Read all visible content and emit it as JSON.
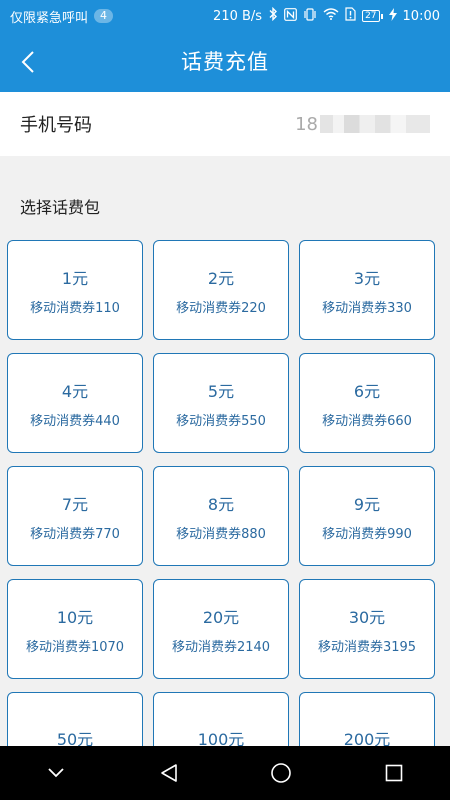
{
  "status_bar": {
    "carrier": "仅限紧急呼叫",
    "notification_count": "4",
    "net_speed": "210 B/s",
    "battery": "27",
    "time": "10:00"
  },
  "app_bar": {
    "title": "话费充值"
  },
  "phone": {
    "label": "手机号码",
    "value_prefix": "18"
  },
  "section": {
    "label": "选择话费包"
  },
  "packages": [
    {
      "price": "1元",
      "desc": "移动消费券110"
    },
    {
      "price": "2元",
      "desc": "移动消费券220"
    },
    {
      "price": "3元",
      "desc": "移动消费券330"
    },
    {
      "price": "4元",
      "desc": "移动消费券440"
    },
    {
      "price": "5元",
      "desc": "移动消费券550"
    },
    {
      "price": "6元",
      "desc": "移动消费券660"
    },
    {
      "price": "7元",
      "desc": "移动消费券770"
    },
    {
      "price": "8元",
      "desc": "移动消费券880"
    },
    {
      "price": "9元",
      "desc": "移动消费券990"
    },
    {
      "price": "10元",
      "desc": "移动消费券1070"
    },
    {
      "price": "20元",
      "desc": "移动消费券2140"
    },
    {
      "price": "30元",
      "desc": "移动消费券3195"
    },
    {
      "price": "50元",
      "desc": ""
    },
    {
      "price": "100元",
      "desc": ""
    },
    {
      "price": "200元",
      "desc": ""
    }
  ],
  "colors": {
    "primary": "#1e8fd9",
    "card_border": "#2077b6",
    "card_text": "#2b6aa0",
    "background": "#f1f1f1"
  }
}
